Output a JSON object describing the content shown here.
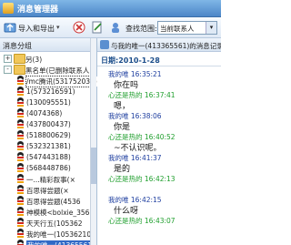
{
  "window": {
    "title": "消息管理器"
  },
  "toolbar": {
    "import_export_label": "导入和导出",
    "search_scope_label": "查找范围:",
    "search_scope_value": "当前联系人"
  },
  "left_panel": {
    "header": "消息分组",
    "tree": [
      {
        "label": "另(3)",
        "kind": "folder",
        "expand": "+"
      },
      {
        "label": "黑名单(已删除联系人(",
        "kind": "folder",
        "expand": "-"
      },
      {
        "label": "/mc腾讯(531752036)",
        "kind": "contact"
      },
      {
        "label": "1(573216591)",
        "kind": "contact"
      },
      {
        "label": "(130095551)",
        "kind": "contact"
      },
      {
        "label": "(4074368)",
        "kind": "contact"
      },
      {
        "label": "(437800437)",
        "kind": "contact"
      },
      {
        "label": "(518800629)",
        "kind": "contact"
      },
      {
        "label": "(532321381)",
        "kind": "contact"
      },
      {
        "label": "(547443188)",
        "kind": "contact"
      },
      {
        "label": "(568448786)",
        "kind": "contact"
      },
      {
        "label": "一...精彩叙事(×",
        "kind": "contact"
      },
      {
        "label": "百思得尝题(×",
        "kind": "contact"
      },
      {
        "label": "百思得尝题(4536",
        "kind": "contact"
      },
      {
        "label": "神模模<bolxie_356",
        "kind": "contact"
      },
      {
        "label": "天天行五(105362",
        "kind": "contact"
      },
      {
        "label": "我的唯一(105362105",
        "kind": "contact"
      },
      {
        "label": "我的唯一(41365561",
        "kind": "contact"
      }
    ]
  },
  "right_panel": {
    "header": "与我的唯一(413365561)的消息记录",
    "date": "日期:2010-1-28",
    "messages": [
      {
        "sender": "我的唯  16:35:21",
        "side": "other",
        "text": "你在吗"
      },
      {
        "sender": "心还是热的  16:37:41",
        "side": "me",
        "text": "嗯，"
      },
      {
        "sender": "我的唯  16:38:06",
        "side": "other",
        "text": "你是"
      },
      {
        "sender": "心还是热的  16:40:52",
        "side": "me",
        "text": "~不认识呢。"
      },
      {
        "sender": "我的唯  16:41:37",
        "side": "other",
        "text": "是的"
      },
      {
        "sender": "心还是热的  16:42:13",
        "side": "me",
        "text": ""
      },
      {
        "sender": "我的唯  16:42:15",
        "side": "other",
        "text": "什么呀"
      },
      {
        "sender": "心还是热的  16:43:07",
        "side": "me",
        "text": ""
      }
    ]
  },
  "colors": {
    "accent": "#3169c6",
    "my_sender": "#1e9e2c",
    "other_sender": "#2040a0"
  }
}
